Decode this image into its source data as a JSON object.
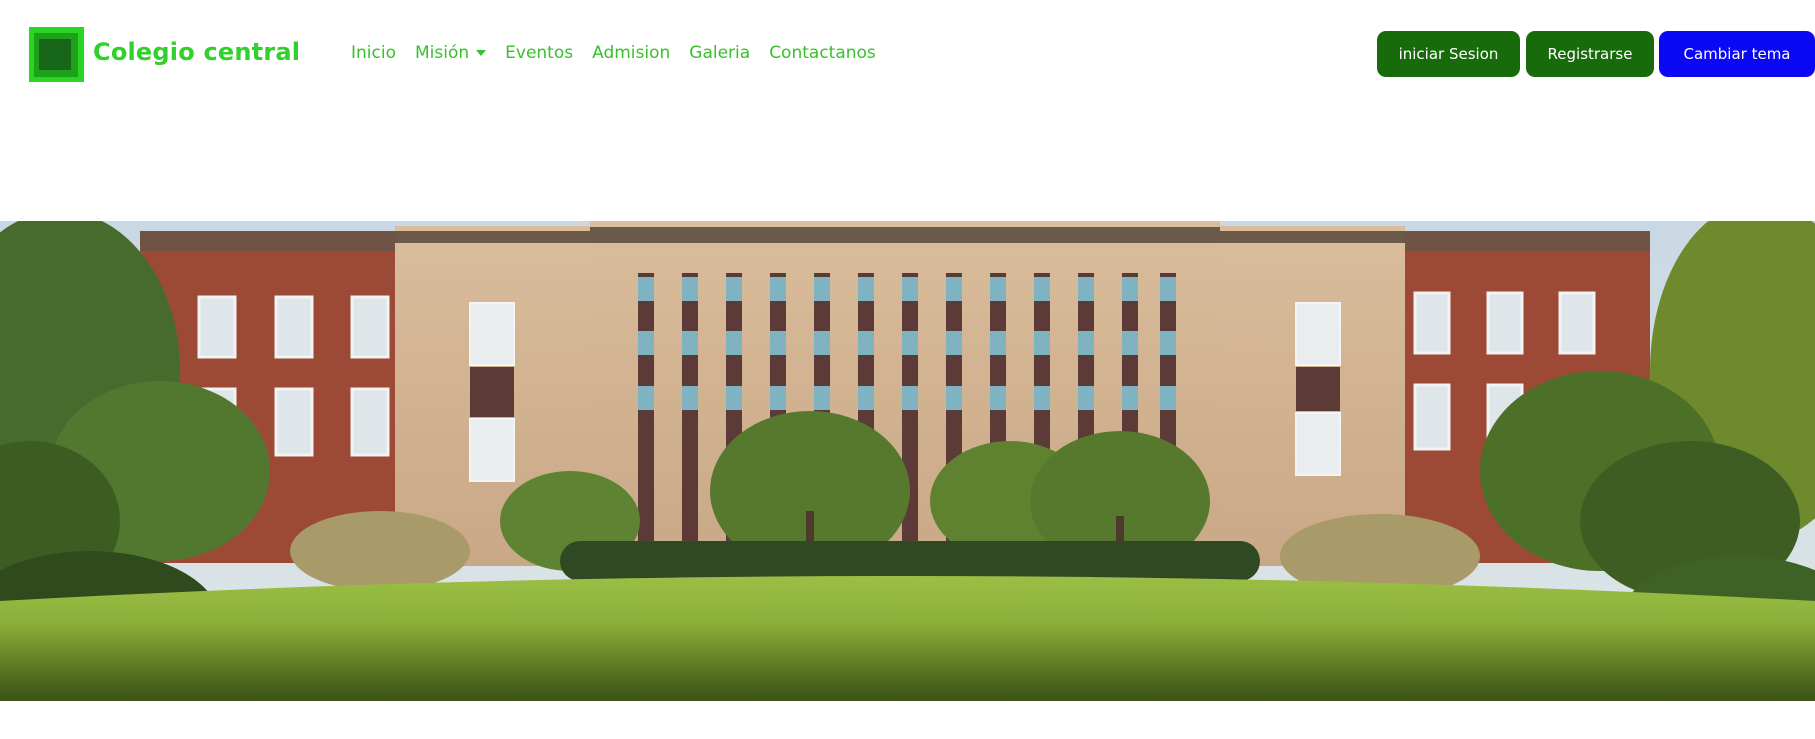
{
  "brand": {
    "name": "Colegio central",
    "logo_icon": "stacked-green-squares-logo"
  },
  "nav": {
    "items": [
      {
        "label": "Inicio"
      },
      {
        "label": "Misión",
        "has_dropdown": true
      },
      {
        "label": "Eventos"
      },
      {
        "label": "Admision"
      },
      {
        "label": "Galeria"
      },
      {
        "label": "Contactanos"
      }
    ]
  },
  "actions": {
    "login_label": "iniciar Sesion",
    "register_label": "Registrarse",
    "theme_label": "Cambiar tema"
  },
  "hero": {
    "image": "school-building-with-lawn-and-trees"
  },
  "colors": {
    "brand_green": "#2fd12a",
    "nav_green": "#37c12a",
    "button_dark_green": "#176b0b",
    "button_blue": "#0a08f5"
  }
}
